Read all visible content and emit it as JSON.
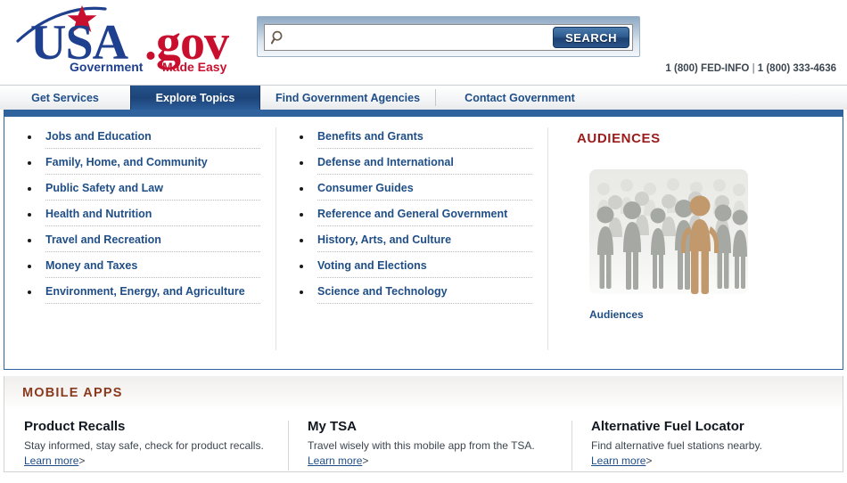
{
  "header": {
    "logo": {
      "usa_text": "USA",
      "dot_gov_text": ".gov",
      "tagline_left": "Government",
      "tagline_right": "Made Easy",
      "blue": "#1f3f8f",
      "red": "#c8102e"
    },
    "search": {
      "value": "",
      "placeholder": "",
      "button_label": "SEARCH",
      "icon": "magnifier-icon"
    },
    "phones": {
      "primary": "1 (800) FED-INFO",
      "separator": "|",
      "secondary": "1 (800) 333-4636"
    }
  },
  "tabs": [
    {
      "label": "Get Services",
      "active": false
    },
    {
      "label": "Explore Topics",
      "active": true
    },
    {
      "label": "Find Government Agencies",
      "active": false
    },
    {
      "label": "Contact Government",
      "active": false
    }
  ],
  "topics": {
    "column_left": [
      "Jobs and Education",
      "Family, Home, and Community",
      "Public Safety and Law",
      "Health and Nutrition",
      "Travel and Recreation",
      "Money and Taxes",
      "Environment, Energy, and Agriculture"
    ],
    "column_middle": [
      "Benefits and Grants",
      "Defense and International",
      "Consumer Guides",
      "Reference and General Government",
      "History, Arts, and Culture",
      "Voting and Elections",
      "Science and Technology"
    ]
  },
  "audiences": {
    "heading": "AUDIENCES",
    "image_alt": "crowd-of-people-silhouettes",
    "link_label": "Audiences",
    "heading_color": "#9b1b1b",
    "highlight_color": "#c2996c"
  },
  "mobile_apps": {
    "heading": "MOBILE APPS",
    "heading_color": "#8a3a1e",
    "items": [
      {
        "title": "Product Recalls",
        "description": "Stay informed, stay safe, check for product recalls.",
        "link_label": "Learn more",
        "link_caret": ">"
      },
      {
        "title": "My TSA",
        "description": "Travel wisely with this mobile app from the TSA.",
        "link_label": "Learn more",
        "link_caret": ">"
      },
      {
        "title": "Alternative Fuel Locator",
        "description": "Find alternative fuel stations nearby.",
        "link_label": "Learn more",
        "link_caret": ">"
      }
    ]
  },
  "colors": {
    "panel_border_blue": "#2e639e",
    "link_blue": "#1f4e87",
    "active_tab_blue": "#1d4478"
  }
}
